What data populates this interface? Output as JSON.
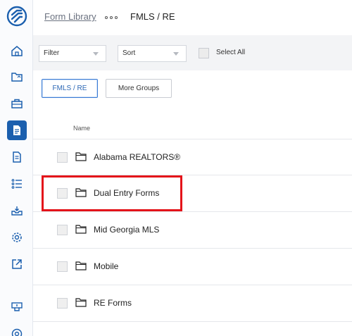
{
  "header": {
    "breadcrumb_link": "Form Library",
    "breadcrumb_current": "FMLS / RE"
  },
  "toolbar": {
    "filter_label": "Filter",
    "sort_label": "Sort",
    "select_all_label": "Select All"
  },
  "groups": {
    "active_label": "FMLS / RE",
    "more_label": "More Groups"
  },
  "list": {
    "column_name": "Name",
    "items": [
      {
        "label": "Alabama REALTORS®"
      },
      {
        "label": "Dual Entry Forms"
      },
      {
        "label": "Mid Georgia MLS"
      },
      {
        "label": "Mobile"
      },
      {
        "label": "RE Forms"
      }
    ]
  },
  "colors": {
    "accent": "#1b5fae",
    "highlight": "#e4131a"
  }
}
